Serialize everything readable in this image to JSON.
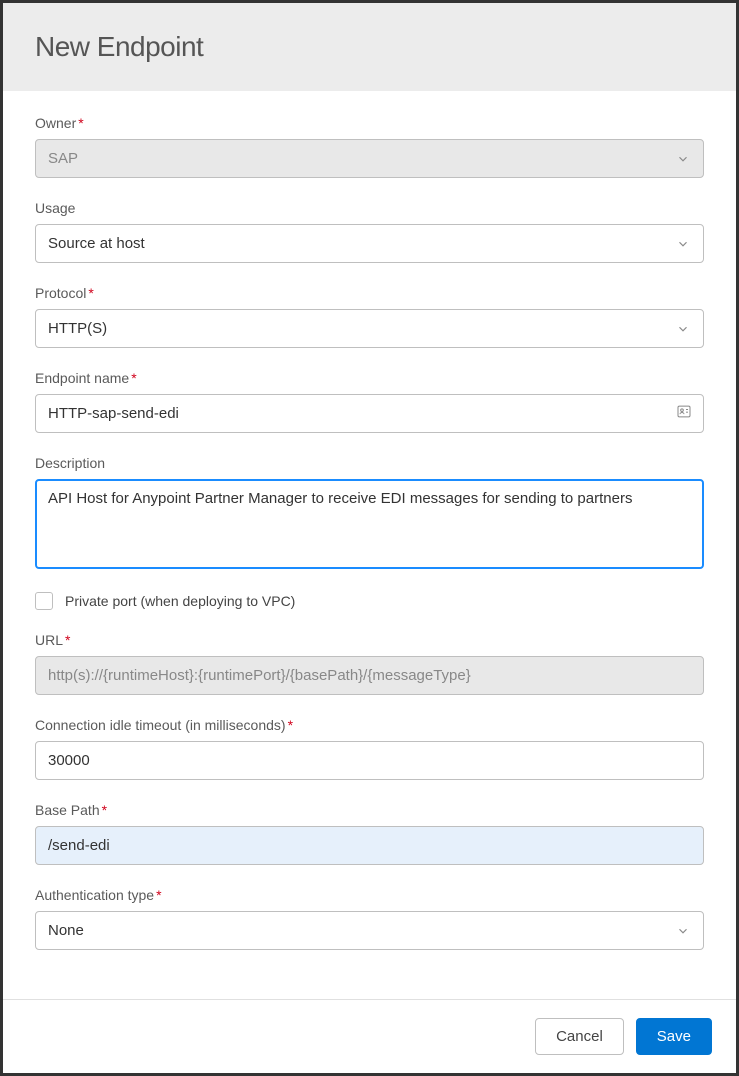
{
  "header": {
    "title": "New Endpoint"
  },
  "fields": {
    "owner": {
      "label": "Owner",
      "value": "SAP"
    },
    "usage": {
      "label": "Usage",
      "value": "Source at host"
    },
    "protocol": {
      "label": "Protocol",
      "value": "HTTP(S)"
    },
    "endpoint_name": {
      "label": "Endpoint name",
      "value": "HTTP-sap-send-edi"
    },
    "description": {
      "label": "Description",
      "value": "API Host for Anypoint Partner Manager to receive EDI messages for sending to partners"
    },
    "private_port": {
      "label": "Private port (when deploying to VPC)",
      "checked": false
    },
    "url": {
      "label": "URL",
      "value": "http(s)://{runtimeHost}:{runtimePort}/{basePath}/{messageType}"
    },
    "connection_timeout": {
      "label": "Connection idle timeout (in milliseconds)",
      "value": "30000"
    },
    "base_path": {
      "label": "Base Path",
      "value": "/send-edi"
    },
    "auth_type": {
      "label": "Authentication type",
      "value": "None"
    }
  },
  "footer": {
    "cancel": "Cancel",
    "save": "Save"
  }
}
